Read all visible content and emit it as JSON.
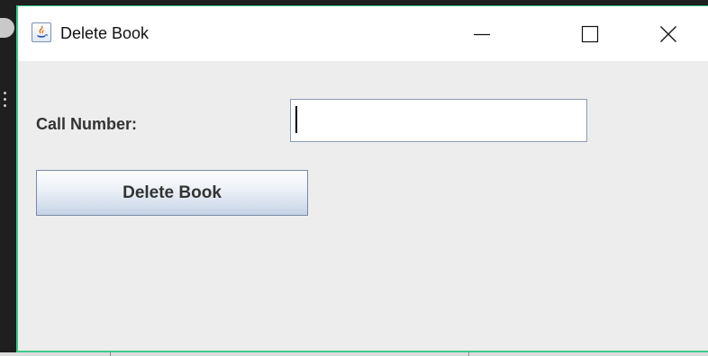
{
  "window": {
    "title": "Delete Book",
    "icon": "java-app-icon",
    "controls": {
      "minimize_icon": "minimize-icon",
      "maximize_icon": "maximize-icon",
      "close_icon": "close-icon"
    },
    "accent_border_color": "#3cc98a"
  },
  "form": {
    "call_number_label": "Call Number:",
    "call_number_value": "",
    "delete_button_label": "Delete Book"
  }
}
